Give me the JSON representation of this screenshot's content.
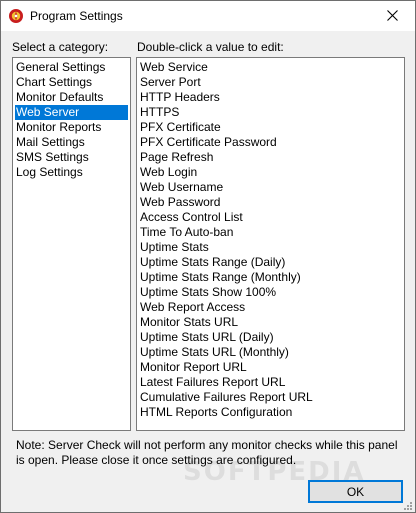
{
  "window": {
    "title": "Program Settings",
    "close_glyph": "✕"
  },
  "left_panel": {
    "label": "Select a category:",
    "categories": [
      "General Settings",
      "Chart Settings",
      "Monitor Defaults",
      "Web Server",
      "Monitor Reports",
      "Mail Settings",
      "SMS Settings",
      "Log Settings"
    ],
    "selected": "Web Server"
  },
  "right_panel": {
    "label": "Double-click a value to edit:",
    "values": [
      "Web Service",
      "Server Port",
      "HTTP Headers",
      "HTTPS",
      "PFX Certificate",
      "PFX Certificate Password",
      "Page Refresh",
      "Web Login",
      "Web Username",
      "Web Password",
      "Access Control List",
      "Time To Auto-ban",
      "Uptime Stats",
      "Uptime Stats Range (Daily)",
      "Uptime Stats Range (Monthly)",
      "Uptime Stats Show 100%",
      "Web Report Access",
      "Monitor Stats URL",
      "Uptime Stats URL (Daily)",
      "Uptime Stats URL (Monthly)",
      "Monitor Report URL",
      "Latest Failures Report URL",
      "Cumulative Failures Report URL",
      "HTML Reports Configuration"
    ]
  },
  "note": "Note: Server Check will not perform any monitor checks while this panel is open. Please close it once settings are configured.",
  "ok_button": "OK",
  "watermark": "SOFTPEDIA",
  "colors": {
    "selection": "#0078d7",
    "background": "#f0f0f0",
    "list_background": "#ffffff"
  },
  "icons": {
    "app": "program-settings-icon",
    "close": "close-icon"
  }
}
